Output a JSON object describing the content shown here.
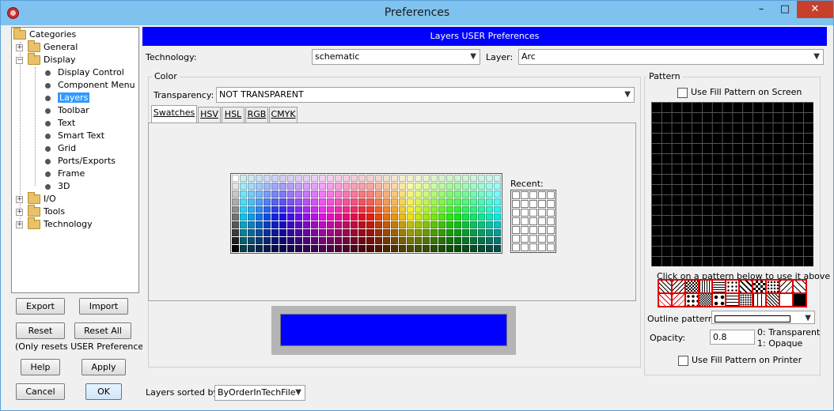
{
  "window": {
    "title": "Preferences"
  },
  "tree": {
    "root": "Categories",
    "general": "General",
    "display": "Display",
    "display_children": [
      "Display Control",
      "Component Menu",
      "Layers",
      "Toolbar",
      "Text",
      "Smart Text",
      "Grid",
      "Ports/Exports",
      "Frame",
      "3D"
    ],
    "io": "I/O",
    "tools": "Tools",
    "technology": "Technology",
    "selected": "Layers"
  },
  "left_buttons": {
    "export": "Export",
    "import": "Import",
    "reset": "Reset",
    "reset_all": "Reset All",
    "note": "(Only resets USER Preferences)",
    "help": "Help",
    "apply": "Apply",
    "cancel": "Cancel",
    "ok": "OK"
  },
  "banner": "Layers USER Preferences",
  "technology": {
    "label": "Technology:",
    "value": "schematic"
  },
  "layer": {
    "label": "Layer:",
    "value": "Arc"
  },
  "color": {
    "group_label": "Color",
    "transparency_label": "Transparency:",
    "transparency_value": "NOT TRANSPARENT",
    "tabs": [
      "Swatches",
      "HSV",
      "HSL",
      "RGB",
      "CMYK"
    ],
    "recent_label": "Recent:",
    "preview_color": "#0000ff"
  },
  "pattern": {
    "group_label": "Pattern",
    "use_fill_screen": "Use Fill Pattern on Screen",
    "hint": "Click on a pattern below to use it above",
    "outline_label": "Outline pattern:",
    "opacity_label": "Opacity:",
    "opacity_value": "0.8",
    "opacity_help_0": "0: Transparent",
    "opacity_help_1": "1: Opaque",
    "use_fill_printer": "Use Fill Pattern on Printer"
  },
  "sort": {
    "label": "Layers sorted by:",
    "value": "ByOrderInTechFile"
  },
  "icons": {
    "folder": "folder-icon",
    "dropdown": "chevron-down-icon",
    "close": "close-icon"
  }
}
